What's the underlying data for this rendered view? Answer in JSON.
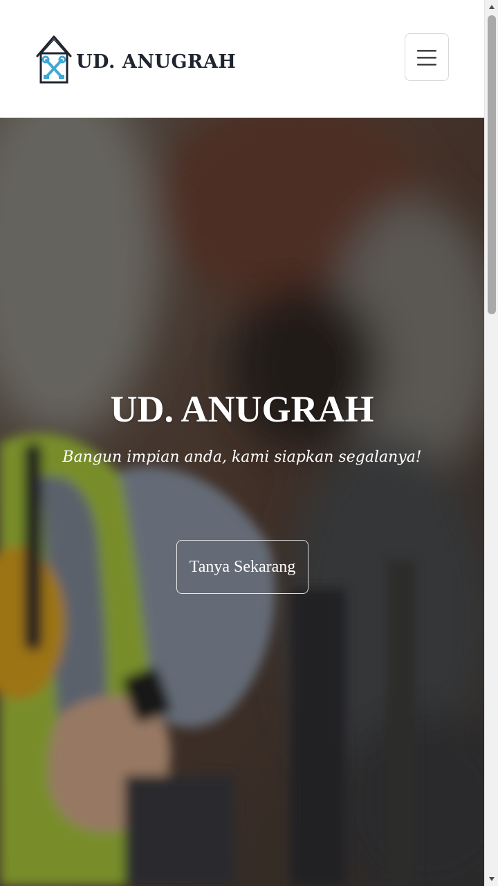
{
  "navbar": {
    "brand_name": "UD. ANUGRAH",
    "menu_icon": "hamburger-menu-icon"
  },
  "hero": {
    "title": "UD. ANUGRAH",
    "subtitle": "Bangun impian anda, kami siapkan segalanya!",
    "cta_label": "Tanya Sekarang",
    "background": "blurred-construction-worker-photo"
  },
  "colors": {
    "brand_text": "#1e2430",
    "logo_accent": "#3fa9d6",
    "hero_text": "#ffffff",
    "navbar_bg": "#ffffff"
  },
  "scrollbar": {
    "position_fraction": 0.0
  }
}
